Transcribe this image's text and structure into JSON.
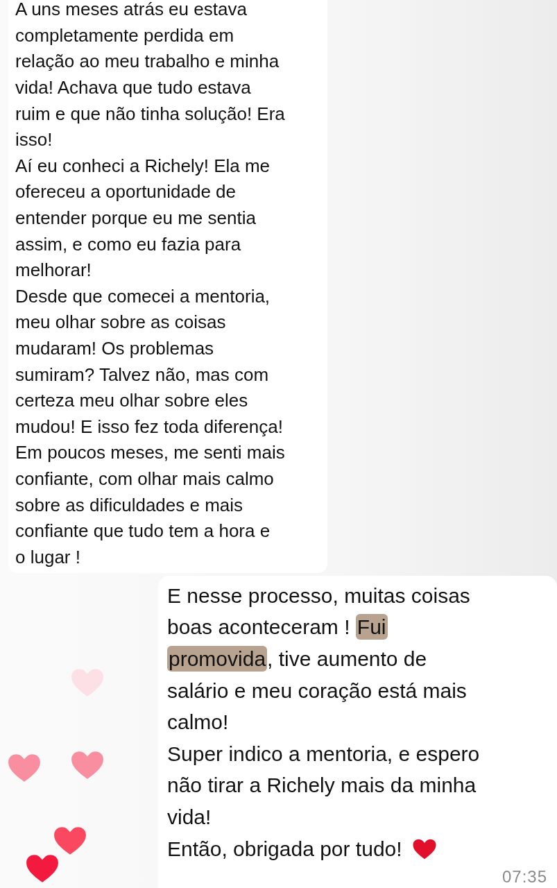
{
  "messages": [
    {
      "kind": "incoming",
      "lines": [
        [
          {
            "text": "A uns meses atrás eu estava",
            "highlighted": false
          }
        ],
        [
          {
            "text": "completamente perdida em",
            "highlighted": false
          }
        ],
        [
          {
            "text": "relação ao meu trabalho e minha",
            "highlighted": false
          }
        ],
        [
          {
            "text": "vida! Achava que tudo estava",
            "highlighted": false
          }
        ],
        [
          {
            "text": "ruim e que não tinha solução! Era",
            "highlighted": false
          }
        ],
        [
          {
            "text": "isso!",
            "highlighted": false
          }
        ],
        [
          {
            "text": "Aí eu conheci a Richely! Ela me",
            "highlighted": false
          }
        ],
        [
          {
            "text": "ofereceu a oportunidade de",
            "highlighted": false
          }
        ],
        [
          {
            "text": "entender porque eu me sentia",
            "highlighted": false
          }
        ],
        [
          {
            "text": "assim, e como eu fazia para",
            "highlighted": false
          }
        ],
        [
          {
            "text": "melhorar!",
            "highlighted": false
          }
        ],
        [
          {
            "text": "Desde que comecei a mentoria,",
            "highlighted": false
          }
        ],
        [
          {
            "text": "meu olhar sobre as coisas",
            "highlighted": false
          }
        ],
        [
          {
            "text": "mudaram! Os problemas",
            "highlighted": false
          }
        ],
        [
          {
            "text": "sumiram? Talvez não, mas com",
            "highlighted": false
          }
        ],
        [
          {
            "text": "certeza meu olhar sobre eles",
            "highlighted": false
          }
        ],
        [
          {
            "text": "mudou! E isso fez toda diferença!",
            "highlighted": false
          }
        ],
        [
          {
            "text": "Em poucos meses, me senti mais",
            "highlighted": false
          }
        ],
        [
          {
            "text": "confiante, com olhar mais calmo",
            "highlighted": false
          }
        ],
        [
          {
            "text": "sobre as dificuldades e mais",
            "highlighted": false
          }
        ],
        [
          {
            "text": "confiante que tudo tem a hora e",
            "highlighted": false
          }
        ],
        [
          {
            "text": "o lugar !",
            "highlighted": false
          }
        ]
      ]
    },
    {
      "kind": "outgoing",
      "time": "07:35",
      "lines": [
        [
          {
            "text": "E nesse processo, muitas coisas",
            "highlighted": false
          }
        ],
        [
          {
            "text": "boas aconteceram ! ",
            "highlighted": false
          },
          {
            "text": "Fui",
            "highlighted": true
          }
        ],
        [
          {
            "text": "promovida",
            "highlighted": true
          },
          {
            "text": ", tive aumento de",
            "highlighted": false
          }
        ],
        [
          {
            "text": "salário e meu coração está mais",
            "highlighted": false
          }
        ],
        [
          {
            "text": "calmo!",
            "highlighted": false
          }
        ],
        [
          {
            "text": "Super indico a mentoria, e espero",
            "highlighted": false
          }
        ],
        [
          {
            "text": "não tirar a Richely mais da minha",
            "highlighted": false
          }
        ],
        [
          {
            "text": "vida!",
            "highlighted": false
          }
        ],
        [
          {
            "text": "Então, obrigada por tudo!",
            "highlighted": false,
            "heart": true
          }
        ]
      ]
    }
  ],
  "floating_hearts": [
    {
      "color": "#fde0e6"
    },
    {
      "color": "#f98ea0"
    },
    {
      "color": "#f98ea0"
    },
    {
      "color": "#f9485f"
    },
    {
      "color": "#f41a3f"
    }
  ]
}
